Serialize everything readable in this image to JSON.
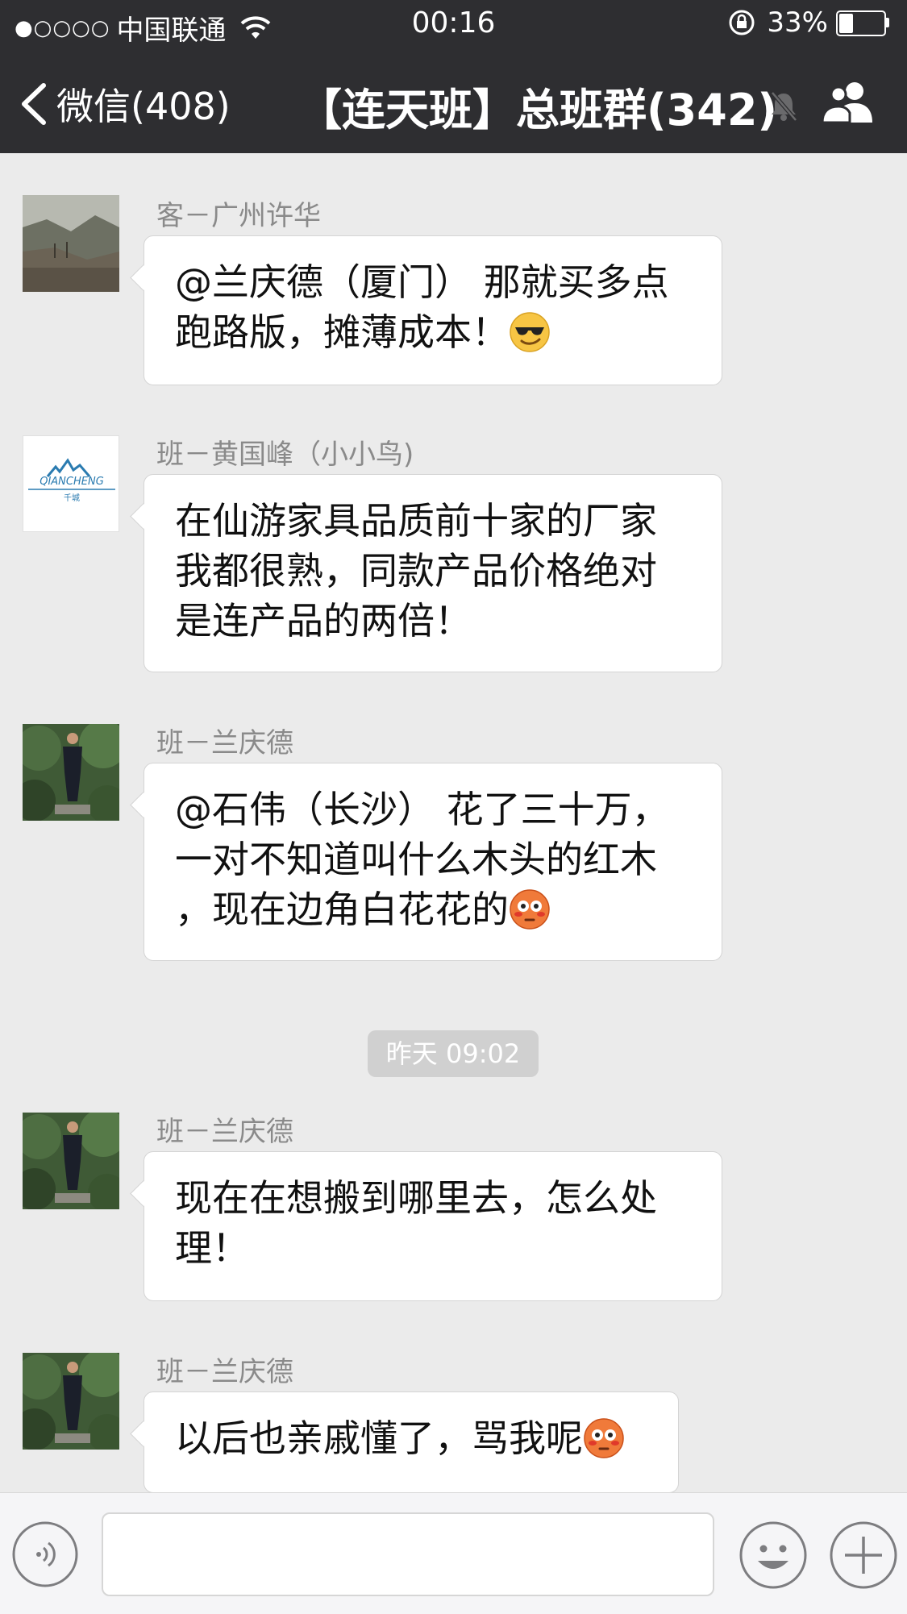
{
  "status_bar": {
    "signal": "●○○○○",
    "carrier": "中国联通",
    "time": "00:16",
    "battery_percent": "33%",
    "battery_level": 0.33
  },
  "nav": {
    "back_label": "微信(408)",
    "title": "【连天班】总班群(342)"
  },
  "messages": [
    {
      "sender": "客－广州许华",
      "text": "@兰庆德（厦门） 那就买多点\n跑路版，摊薄成本！",
      "emoji": "cool-emoji"
    },
    {
      "sender": "班－黄国峰（小小鸟)",
      "avatar_text": "QIANCHENG",
      "avatar_subtext": "千城",
      "text": "在仙游家具品质前十家的厂家\n我都很熟，同款产品价格绝对\n是连产品的两倍！"
    },
    {
      "sender": "班－兰庆德",
      "text": "@石伟（长沙） 花了三十万，\n一对不知道叫什么木头的红木\n，现在边角白花花的",
      "emoji": "flushed-emoji"
    },
    {
      "sender": "班－兰庆德",
      "text": "现在在想搬到哪里去，怎么处\n理！"
    },
    {
      "sender": "班－兰庆德",
      "text": "以后也亲戚懂了，骂我呢",
      "emoji": "flushed-emoji"
    }
  ],
  "time_divider": "昨天 09:02",
  "input": {
    "value": ""
  },
  "colors": {
    "header_bg": "#2e2e31",
    "chat_bg": "#ebebeb",
    "bubble_bg": "#ffffff",
    "sender_text": "#8a8a8a"
  }
}
